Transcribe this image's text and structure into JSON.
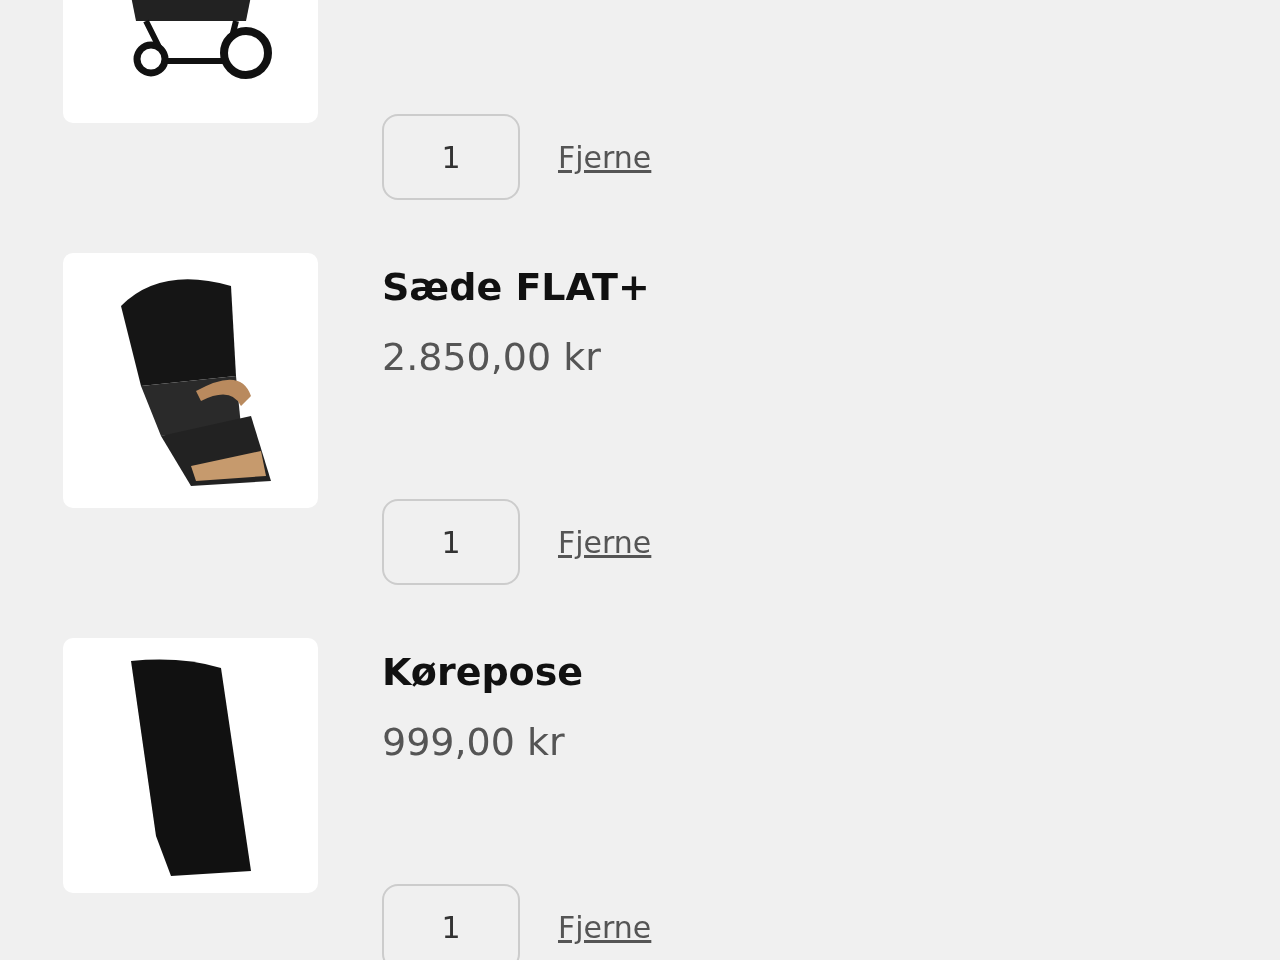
{
  "cart_items": [
    {
      "kind": "stroller",
      "quantity": "1",
      "remove_label": "Fjerne"
    },
    {
      "kind": "seat",
      "name": "Sæde FLAT+",
      "price": "2.850,00 kr",
      "quantity": "1",
      "remove_label": "Fjerne"
    },
    {
      "kind": "footmuff",
      "name": "Kørepose",
      "price": "999,00 kr",
      "quantity": "1",
      "remove_label": "Fjerne"
    }
  ]
}
